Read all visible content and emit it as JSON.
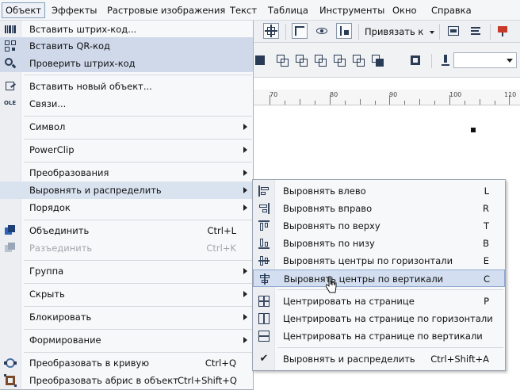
{
  "menubar": {
    "items": [
      {
        "label": "Объект",
        "active": true
      },
      {
        "label": "Эффекты"
      },
      {
        "label": "Растровые изображения"
      },
      {
        "label": "Текст"
      },
      {
        "label": "Таблица"
      },
      {
        "label": "Инструменты"
      },
      {
        "label": "Окно"
      },
      {
        "label": "Справка"
      }
    ]
  },
  "toolbar": {
    "snap_label": "Привязать к"
  },
  "ruler": {
    "labels": [
      "70",
      "80",
      "90",
      "100",
      "110"
    ]
  },
  "main_menu": {
    "items": [
      {
        "label": "Вставить штрих-код...",
        "icon": "barcode-icon"
      },
      {
        "label": "Вставить QR-код",
        "icon": "qr-code-icon",
        "highlight": true
      },
      {
        "label": "Проверить штрих-код",
        "icon": "magnifier-icon",
        "highlight": true
      },
      {
        "label": "Вставить новый объект...",
        "icon": "new-object-icon"
      },
      {
        "label": "Связи...",
        "icon": "ole-icon"
      },
      {
        "label": "Символ",
        "submenu": true
      },
      {
        "label": "PowerClip",
        "submenu": true
      },
      {
        "label": "Преобразования",
        "submenu": true
      },
      {
        "label": "Выровнять и распределить",
        "submenu": true,
        "highlight": true
      },
      {
        "label": "Порядок",
        "submenu": true
      },
      {
        "label": "Объединить",
        "shortcut": "Ctrl+L",
        "icon": "combine-icon"
      },
      {
        "label": "Разъединить",
        "shortcut": "Ctrl+K",
        "icon": "break-apart-icon",
        "disabled": true
      },
      {
        "label": "Группа",
        "submenu": true
      },
      {
        "label": "Скрыть",
        "submenu": true
      },
      {
        "label": "Блокировать",
        "submenu": true
      },
      {
        "label": "Формирование",
        "submenu": true
      },
      {
        "label": "Преобразовать в кривую",
        "shortcut": "Ctrl+Q",
        "icon": "convert-curve-icon"
      },
      {
        "label": "Преобразовать абрис в объект",
        "shortcut": "Ctrl+Shift+Q",
        "icon": "outline-to-object-icon"
      }
    ]
  },
  "submenu": {
    "items": [
      {
        "label": "Выровнять влево",
        "key": "L",
        "icon": "align-left-icon"
      },
      {
        "label": "Выровнять вправо",
        "key": "R",
        "icon": "align-right-icon"
      },
      {
        "label": "Выровнять по верху",
        "key": "T",
        "icon": "align-top-icon"
      },
      {
        "label": "Выровнять по низу",
        "key": "B",
        "icon": "align-bottom-icon"
      },
      {
        "label": "Выровнять центры по горизонтали",
        "key": "E",
        "icon": "align-center-horizontal-icon"
      },
      {
        "label": "Выровнять центры по вертикали",
        "key": "C",
        "icon": "align-center-vertical-icon",
        "highlight": true
      },
      {
        "label": "Центрировать на странице",
        "key": "P",
        "icon": "center-page-icon"
      },
      {
        "label": "Центрировать на странице по горизонтали",
        "key": "",
        "icon": "center-page-horizontal-icon"
      },
      {
        "label": "Центрировать на странице по вертикали",
        "key": "",
        "icon": "center-page-vertical-icon"
      },
      {
        "label": "Выровнять и распределить",
        "key": "Ctrl+Shift+A",
        "icon": "checkmark-icon"
      }
    ]
  }
}
